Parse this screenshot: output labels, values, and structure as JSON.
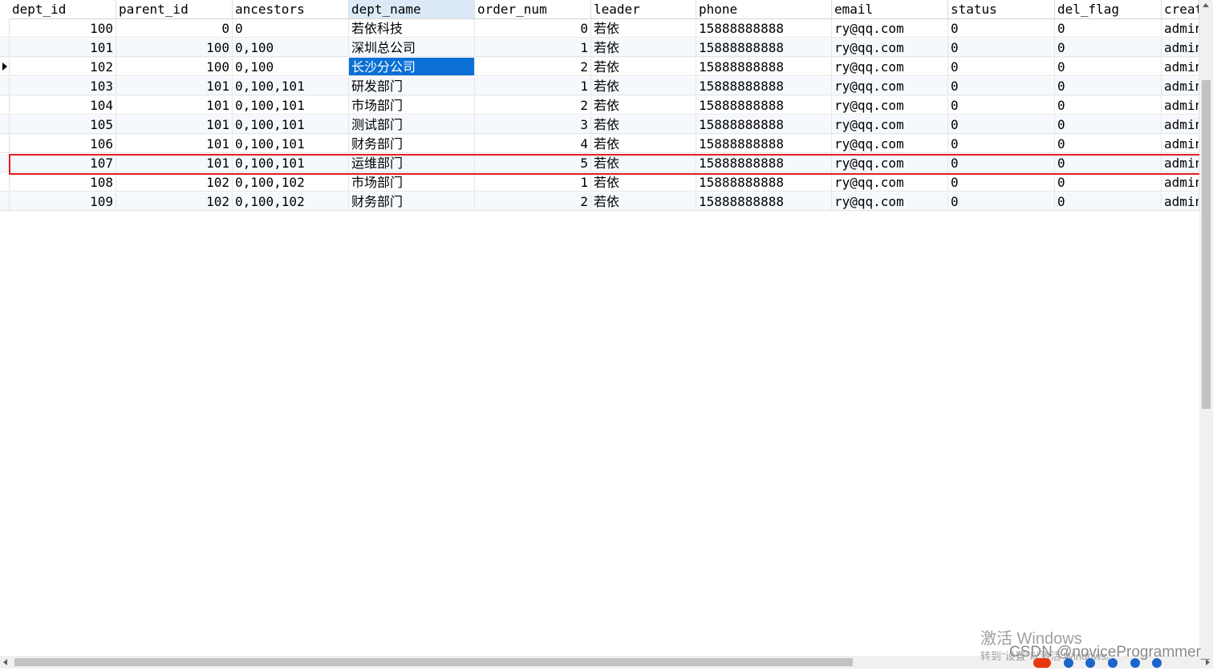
{
  "columns": [
    "dept_id",
    "parent_id",
    "ancestors",
    "dept_name",
    "order_num",
    "leader",
    "phone",
    "email",
    "status",
    "del_flag",
    "creat"
  ],
  "rows": [
    [
      "100",
      "0",
      "0",
      "若依科技",
      "0",
      "若依",
      "15888888888",
      "ry@qq.com",
      "0",
      "0",
      "admin"
    ],
    [
      "101",
      "100",
      "0,100",
      "深圳总公司",
      "1",
      "若依",
      "15888888888",
      "ry@qq.com",
      "0",
      "0",
      "admin"
    ],
    [
      "102",
      "100",
      "0,100",
      "长沙分公司",
      "2",
      "若依",
      "15888888888",
      "ry@qq.com",
      "0",
      "0",
      "admin"
    ],
    [
      "103",
      "101",
      "0,100,101",
      "研发部门",
      "1",
      "若依",
      "15888888888",
      "ry@qq.com",
      "0",
      "0",
      "admin"
    ],
    [
      "104",
      "101",
      "0,100,101",
      "市场部门",
      "2",
      "若依",
      "15888888888",
      "ry@qq.com",
      "0",
      "0",
      "admin"
    ],
    [
      "105",
      "101",
      "0,100,101",
      "测试部门",
      "3",
      "若依",
      "15888888888",
      "ry@qq.com",
      "0",
      "0",
      "admin"
    ],
    [
      "106",
      "101",
      "0,100,101",
      "财务部门",
      "4",
      "若依",
      "15888888888",
      "ry@qq.com",
      "0",
      "0",
      "admin"
    ],
    [
      "107",
      "101",
      "0,100,101",
      "运维部门",
      "5",
      "若依",
      "15888888888",
      "ry@qq.com",
      "0",
      "0",
      "admin"
    ],
    [
      "108",
      "102",
      "0,100,102",
      "市场部门",
      "1",
      "若依",
      "15888888888",
      "ry@qq.com",
      "0",
      "0",
      "admin"
    ],
    [
      "109",
      "102",
      "0,100,102",
      "财务部门",
      "2",
      "若依",
      "15888888888",
      "ry@qq.com",
      "0",
      "0",
      "admin"
    ]
  ],
  "colors": {
    "selected_cell": "#0a70d6",
    "highlight_box": "#e02020",
    "sorted_header": "#dceaf7"
  },
  "watermark": {
    "title": "激活 Windows",
    "subtitle": "转到\"设置\"以激活 Windows。",
    "csdn": "CSDN @noviceProgrammer_"
  }
}
